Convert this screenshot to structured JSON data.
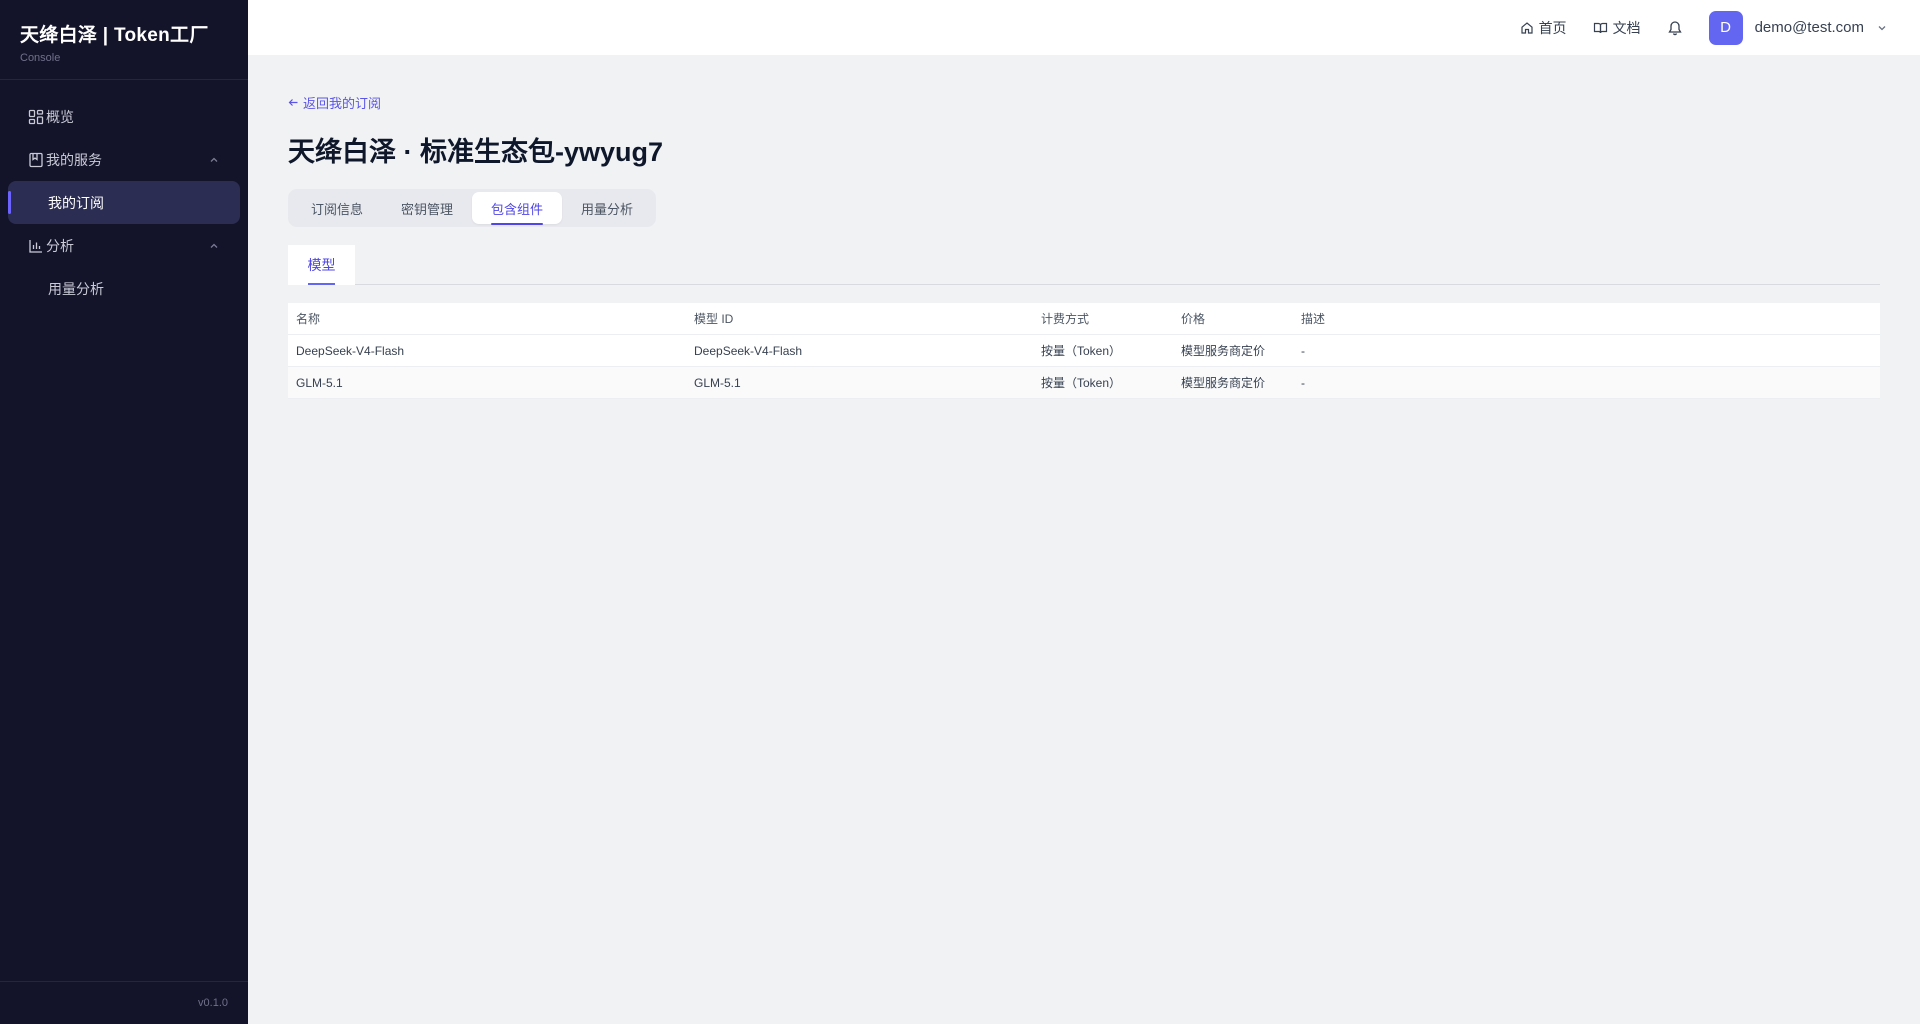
{
  "brand": {
    "title": "天绛白泽 | Token工厂",
    "subtitle": "Console"
  },
  "sidebar": {
    "items": [
      {
        "label": "概览",
        "icon": "dashboard-icon"
      },
      {
        "label": "我的服务",
        "icon": "book-icon",
        "expanded": true
      },
      {
        "label": "我的订阅",
        "active": true
      },
      {
        "label": "分析",
        "icon": "bar-chart-icon",
        "expanded": true
      },
      {
        "label": "用量分析"
      }
    ],
    "version": "v0.1.0"
  },
  "header": {
    "home_label": "首页",
    "docs_label": "文档",
    "avatar_letter": "D",
    "user_email": "demo@test.com"
  },
  "main": {
    "back_label": "返回我的订阅",
    "title": "天绛白泽 · 标准生态包-ywyug7",
    "tabs": [
      {
        "label": "订阅信息"
      },
      {
        "label": "密钥管理"
      },
      {
        "label": "包含组件",
        "active": true
      },
      {
        "label": "用量分析"
      }
    ],
    "subtab": "模型",
    "table": {
      "headers": [
        "名称",
        "模型 ID",
        "计费方式",
        "价格",
        "描述"
      ],
      "rows": [
        [
          "DeepSeek-V4-Flash",
          "DeepSeek-V4-Flash",
          "按量（Token）",
          "模型服务商定价",
          "-"
        ],
        [
          "GLM-5.1",
          "GLM-5.1",
          "按量（Token）",
          "模型服务商定价",
          "-"
        ]
      ]
    }
  },
  "colors": {
    "accent": "#4f46e5",
    "sidebar_bg": "#13132a",
    "page_bg": "#f1f2f4"
  }
}
